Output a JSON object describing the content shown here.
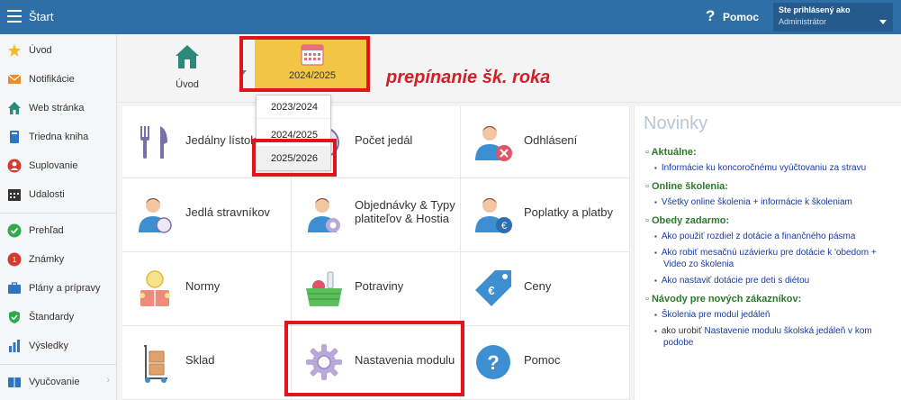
{
  "topbar": {
    "title": "Štart",
    "help_label": "Pomoc",
    "help_icon": "question-icon",
    "user_line1": "Ste prihlásený ako",
    "user_line2": "Administrátor"
  },
  "sidebar": {
    "items": [
      {
        "label": "Úvod",
        "icon": "star-icon",
        "color": "#f5b820"
      },
      {
        "label": "Notifikácie",
        "icon": "envelope-icon",
        "color": "#f08a24"
      },
      {
        "label": "Web stránka",
        "icon": "home-icon",
        "color": "#2b8a7a"
      },
      {
        "label": "Triedna kniha",
        "icon": "book-icon",
        "color": "#2f76c2"
      },
      {
        "label": "Suplovanie",
        "icon": "person-icon",
        "color": "#d43a2f"
      },
      {
        "label": "Udalosti",
        "icon": "calendar-icon",
        "color": "#333333"
      },
      {
        "label": "Prehľad",
        "icon": "check-icon",
        "color": "#2eaa4a"
      },
      {
        "label": "Známky",
        "icon": "grade-icon",
        "color": "#d43a2f"
      },
      {
        "label": "Plány a prípravy",
        "icon": "briefcase-icon",
        "color": "#2f76c2"
      },
      {
        "label": "Štandardy",
        "icon": "shield-icon",
        "color": "#2eaa4a"
      },
      {
        "label": "Výsledky",
        "icon": "bar-chart-icon",
        "color": "#2f76c2"
      },
      {
        "label": "Vyučovanie",
        "icon": "book-icon",
        "color": "#2f76c2"
      }
    ]
  },
  "toolbar": {
    "home_label": "Úvod",
    "year_label": "2024/2025",
    "annotation": "prepínanie šk. roka"
  },
  "dropdown": {
    "options": [
      "2023/2024",
      "2024/2025",
      "2025/2026"
    ],
    "selected": "2025/2026"
  },
  "tiles": [
    {
      "label": "Jedálny lístok",
      "icon": "cutlery-icon"
    },
    {
      "label": "Počet jedál",
      "icon": "plate-icon"
    },
    {
      "label": "Odhlásení",
      "icon": "user-remove-icon"
    },
    {
      "label": "Jedlá stravníkov",
      "icon": "user-meal-icon"
    },
    {
      "label": "Objednávky & Typy platiteľov & Hostia",
      "icon": "user-gear-icon"
    },
    {
      "label": "Poplatky a platby",
      "icon": "user-euro-icon"
    },
    {
      "label": "Normy",
      "icon": "reader-icon"
    },
    {
      "label": "Potraviny",
      "icon": "basket-icon"
    },
    {
      "label": "Ceny",
      "icon": "price-tag-icon"
    },
    {
      "label": "Sklad",
      "icon": "hand-truck-icon"
    },
    {
      "label": "Nastavenia modulu",
      "icon": "gear-icon"
    },
    {
      "label": "Pomoc",
      "icon": "help-circle-icon"
    }
  ],
  "news": {
    "title": "Novinky",
    "sections": [
      {
        "head": "Aktuálne:",
        "links": [
          {
            "text": "Informácie ku koncoročnému vyúčtovaniu za stravu"
          }
        ]
      },
      {
        "head": "Online školenia:",
        "links": [
          {
            "text": "Všetky online školenia + informácie k školeniam"
          }
        ]
      },
      {
        "head": "Obedy zadarmo:",
        "links": [
          {
            "text": "Ako použiť rozdiel z dotácie a finančného pásma"
          },
          {
            "text": "Ako robiť mesačnú uzávierku pre dotácie k 'obedom + Video zo školenia"
          },
          {
            "text": "Ako nastaviť dotácie pre deti s diétou"
          }
        ]
      },
      {
        "head": "Návody pre nových zákazníkov:",
        "links": [
          {
            "text": "Školenia pre modul jedáleň"
          },
          {
            "prefix": "ako urobiť ",
            "text": "Nastavenie modulu školská jedáleň v kom podobe"
          }
        ]
      }
    ]
  }
}
